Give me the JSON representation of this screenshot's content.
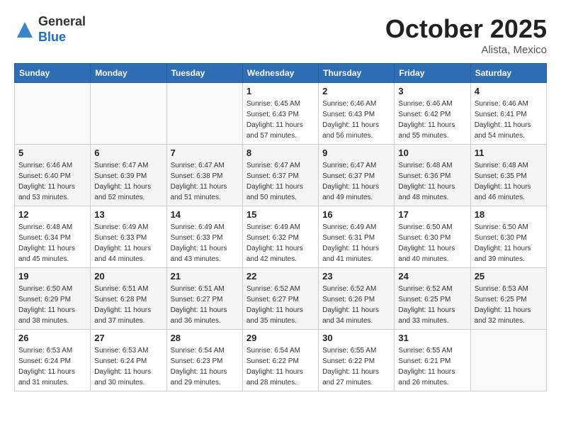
{
  "header": {
    "logo_general": "General",
    "logo_blue": "Blue",
    "month": "October 2025",
    "location": "Alista, Mexico"
  },
  "weekdays": [
    "Sunday",
    "Monday",
    "Tuesday",
    "Wednesday",
    "Thursday",
    "Friday",
    "Saturday"
  ],
  "weeks": [
    [
      {
        "day": "",
        "info": ""
      },
      {
        "day": "",
        "info": ""
      },
      {
        "day": "",
        "info": ""
      },
      {
        "day": "1",
        "info": "Sunrise: 6:45 AM\nSunset: 6:43 PM\nDaylight: 11 hours\nand 57 minutes."
      },
      {
        "day": "2",
        "info": "Sunrise: 6:46 AM\nSunset: 6:43 PM\nDaylight: 11 hours\nand 56 minutes."
      },
      {
        "day": "3",
        "info": "Sunrise: 6:46 AM\nSunset: 6:42 PM\nDaylight: 11 hours\nand 55 minutes."
      },
      {
        "day": "4",
        "info": "Sunrise: 6:46 AM\nSunset: 6:41 PM\nDaylight: 11 hours\nand 54 minutes."
      }
    ],
    [
      {
        "day": "5",
        "info": "Sunrise: 6:46 AM\nSunset: 6:40 PM\nDaylight: 11 hours\nand 53 minutes."
      },
      {
        "day": "6",
        "info": "Sunrise: 6:47 AM\nSunset: 6:39 PM\nDaylight: 11 hours\nand 52 minutes."
      },
      {
        "day": "7",
        "info": "Sunrise: 6:47 AM\nSunset: 6:38 PM\nDaylight: 11 hours\nand 51 minutes."
      },
      {
        "day": "8",
        "info": "Sunrise: 6:47 AM\nSunset: 6:37 PM\nDaylight: 11 hours\nand 50 minutes."
      },
      {
        "day": "9",
        "info": "Sunrise: 6:47 AM\nSunset: 6:37 PM\nDaylight: 11 hours\nand 49 minutes."
      },
      {
        "day": "10",
        "info": "Sunrise: 6:48 AM\nSunset: 6:36 PM\nDaylight: 11 hours\nand 48 minutes."
      },
      {
        "day": "11",
        "info": "Sunrise: 6:48 AM\nSunset: 6:35 PM\nDaylight: 11 hours\nand 46 minutes."
      }
    ],
    [
      {
        "day": "12",
        "info": "Sunrise: 6:48 AM\nSunset: 6:34 PM\nDaylight: 11 hours\nand 45 minutes."
      },
      {
        "day": "13",
        "info": "Sunrise: 6:49 AM\nSunset: 6:33 PM\nDaylight: 11 hours\nand 44 minutes."
      },
      {
        "day": "14",
        "info": "Sunrise: 6:49 AM\nSunset: 6:33 PM\nDaylight: 11 hours\nand 43 minutes."
      },
      {
        "day": "15",
        "info": "Sunrise: 6:49 AM\nSunset: 6:32 PM\nDaylight: 11 hours\nand 42 minutes."
      },
      {
        "day": "16",
        "info": "Sunrise: 6:49 AM\nSunset: 6:31 PM\nDaylight: 11 hours\nand 41 minutes."
      },
      {
        "day": "17",
        "info": "Sunrise: 6:50 AM\nSunset: 6:30 PM\nDaylight: 11 hours\nand 40 minutes."
      },
      {
        "day": "18",
        "info": "Sunrise: 6:50 AM\nSunset: 6:30 PM\nDaylight: 11 hours\nand 39 minutes."
      }
    ],
    [
      {
        "day": "19",
        "info": "Sunrise: 6:50 AM\nSunset: 6:29 PM\nDaylight: 11 hours\nand 38 minutes."
      },
      {
        "day": "20",
        "info": "Sunrise: 6:51 AM\nSunset: 6:28 PM\nDaylight: 11 hours\nand 37 minutes."
      },
      {
        "day": "21",
        "info": "Sunrise: 6:51 AM\nSunset: 6:27 PM\nDaylight: 11 hours\nand 36 minutes."
      },
      {
        "day": "22",
        "info": "Sunrise: 6:52 AM\nSunset: 6:27 PM\nDaylight: 11 hours\nand 35 minutes."
      },
      {
        "day": "23",
        "info": "Sunrise: 6:52 AM\nSunset: 6:26 PM\nDaylight: 11 hours\nand 34 minutes."
      },
      {
        "day": "24",
        "info": "Sunrise: 6:52 AM\nSunset: 6:25 PM\nDaylight: 11 hours\nand 33 minutes."
      },
      {
        "day": "25",
        "info": "Sunrise: 6:53 AM\nSunset: 6:25 PM\nDaylight: 11 hours\nand 32 minutes."
      }
    ],
    [
      {
        "day": "26",
        "info": "Sunrise: 6:53 AM\nSunset: 6:24 PM\nDaylight: 11 hours\nand 31 minutes."
      },
      {
        "day": "27",
        "info": "Sunrise: 6:53 AM\nSunset: 6:24 PM\nDaylight: 11 hours\nand 30 minutes."
      },
      {
        "day": "28",
        "info": "Sunrise: 6:54 AM\nSunset: 6:23 PM\nDaylight: 11 hours\nand 29 minutes."
      },
      {
        "day": "29",
        "info": "Sunrise: 6:54 AM\nSunset: 6:22 PM\nDaylight: 11 hours\nand 28 minutes."
      },
      {
        "day": "30",
        "info": "Sunrise: 6:55 AM\nSunset: 6:22 PM\nDaylight: 11 hours\nand 27 minutes."
      },
      {
        "day": "31",
        "info": "Sunrise: 6:55 AM\nSunset: 6:21 PM\nDaylight: 11 hours\nand 26 minutes."
      },
      {
        "day": "",
        "info": ""
      }
    ]
  ]
}
